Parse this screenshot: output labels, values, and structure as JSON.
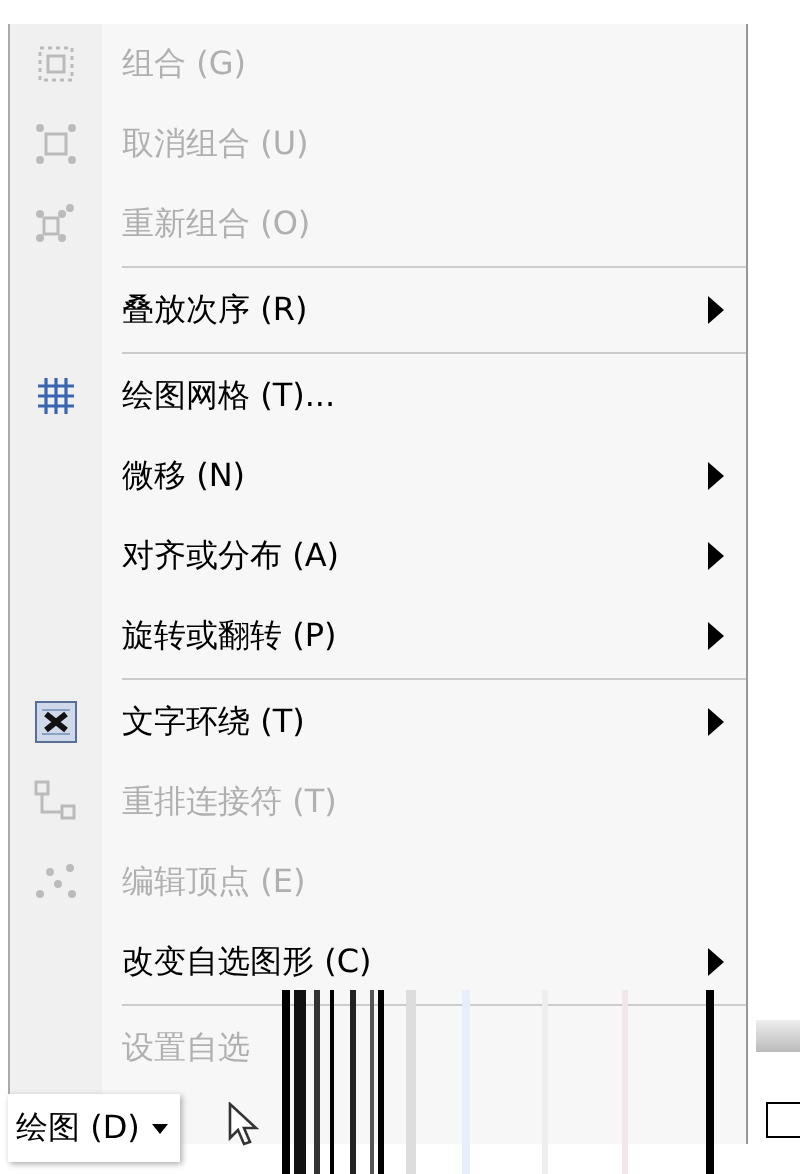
{
  "menu": {
    "items": [
      {
        "kind": "item",
        "label": "组合 (G)",
        "disabled": true,
        "submenu": false
      },
      {
        "kind": "item",
        "label": "取消组合 (U)",
        "disabled": true,
        "submenu": false
      },
      {
        "kind": "item",
        "label": "重新组合 (O)",
        "disabled": true,
        "submenu": false
      },
      {
        "kind": "separator"
      },
      {
        "kind": "item",
        "label": "叠放次序 (R)",
        "disabled": false,
        "submenu": true
      },
      {
        "kind": "separator"
      },
      {
        "kind": "item",
        "label": "绘图网格 (T)...",
        "disabled": false,
        "submenu": false
      },
      {
        "kind": "item",
        "label": "微移 (N)",
        "disabled": false,
        "submenu": true
      },
      {
        "kind": "item",
        "label": "对齐或分布 (A)",
        "disabled": false,
        "submenu": true
      },
      {
        "kind": "item",
        "label": "旋转或翻转 (P)",
        "disabled": false,
        "submenu": true
      },
      {
        "kind": "separator"
      },
      {
        "kind": "item",
        "label": "文字环绕 (T)",
        "disabled": false,
        "submenu": true
      },
      {
        "kind": "item",
        "label": "重排连接符 (T)",
        "disabled": true,
        "submenu": false
      },
      {
        "kind": "item",
        "label": "编辑顶点 (E)",
        "disabled": true,
        "submenu": false
      },
      {
        "kind": "item",
        "label": "改变自选图形 (C)",
        "disabled": false,
        "submenu": true
      },
      {
        "kind": "separator"
      },
      {
        "kind": "item",
        "label": "设置自选",
        "disabled": true,
        "submenu": false
      }
    ]
  },
  "toolbar": {
    "draw_button": {
      "label": "绘图 (D)"
    }
  }
}
